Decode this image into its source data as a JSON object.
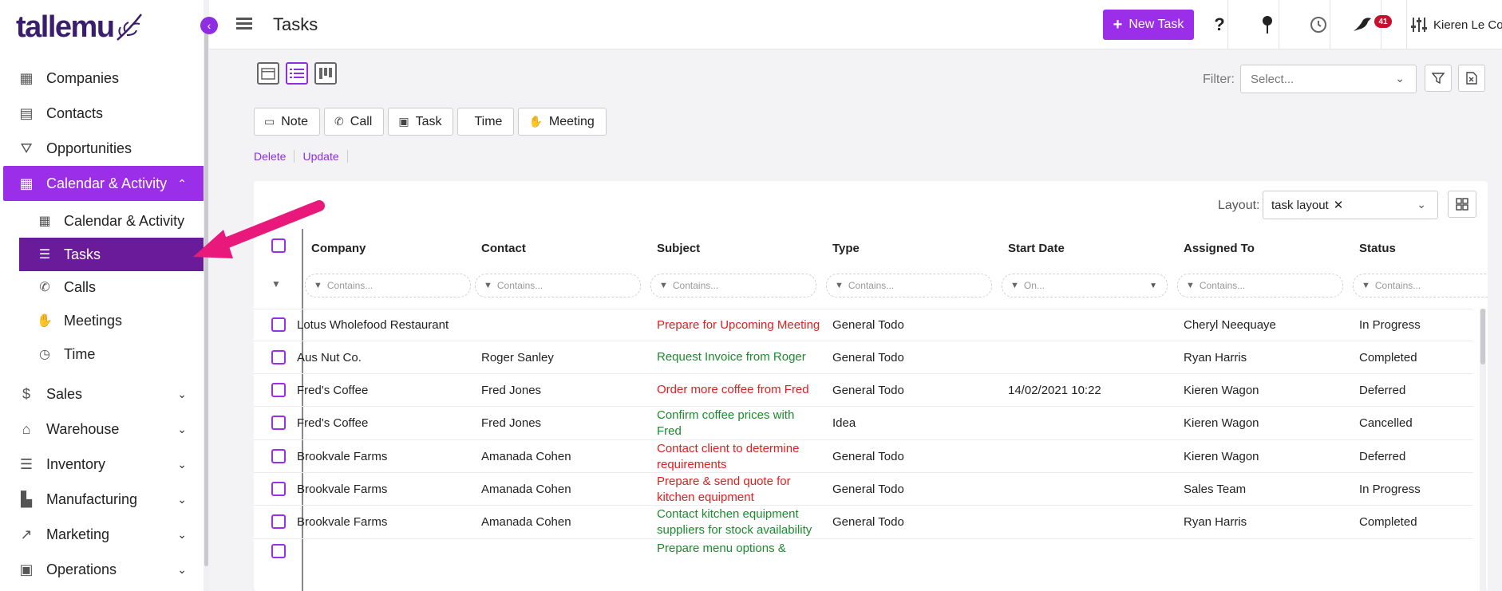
{
  "app": {
    "logo": "tallemu"
  },
  "sidebar": {
    "items": [
      {
        "label": "Companies",
        "icon": "building-icon",
        "glyph": "▦"
      },
      {
        "label": "Contacts",
        "icon": "contact-card-icon",
        "glyph": "▤"
      },
      {
        "label": "Opportunities",
        "icon": "funnel-icon",
        "glyph": "⛛"
      },
      {
        "label": "Calendar & Activity",
        "icon": "calendar-icon",
        "glyph": "▦",
        "expanded": true
      },
      {
        "label": "Sales",
        "icon": "dollar-icon",
        "glyph": "$"
      },
      {
        "label": "Warehouse",
        "icon": "warehouse-icon",
        "glyph": "⌂"
      },
      {
        "label": "Inventory",
        "icon": "clipboard-icon",
        "glyph": "☰"
      },
      {
        "label": "Manufacturing",
        "icon": "factory-icon",
        "glyph": "▙"
      },
      {
        "label": "Marketing",
        "icon": "chart-icon",
        "glyph": "↗"
      },
      {
        "label": "Operations",
        "icon": "clipboard-check-icon",
        "glyph": "▣"
      }
    ],
    "sub_items": [
      {
        "label": "Calendar & Activity",
        "icon": "calendar-icon",
        "glyph": "▦"
      },
      {
        "label": "Tasks",
        "icon": "tasks-list-icon",
        "glyph": "☰",
        "active": true
      },
      {
        "label": "Calls",
        "icon": "phone-icon",
        "glyph": "✆"
      },
      {
        "label": "Meetings",
        "icon": "handshake-icon",
        "glyph": "✋"
      },
      {
        "label": "Time",
        "icon": "stopwatch-icon",
        "glyph": "◷"
      }
    ]
  },
  "topbar": {
    "title": "Tasks",
    "new_task_label": "New Task",
    "notification_count": "41",
    "user_name": "Kieren Le Cor"
  },
  "toolbar": {
    "filter_label": "Filter:",
    "filter_placeholder": "Select...",
    "actions": [
      "Note",
      "Call",
      "Task",
      "Time",
      "Meeting"
    ],
    "links": [
      "Delete",
      "Update"
    ]
  },
  "grid": {
    "layout_label": "Layout:",
    "layout_value": "task layout",
    "columns": [
      "Company",
      "Contact",
      "Subject",
      "Type",
      "Start Date",
      "Assigned To",
      "Status"
    ],
    "filter_placeholders": [
      "Contains...",
      "Contains...",
      "Contains...",
      "Contains...",
      "On...",
      "Contains...",
      "Contains..."
    ],
    "rows": [
      {
        "company": "Lotus Wholefood Restaurant",
        "contact": "",
        "subject": [
          "Prepare for Upcoming Meeting"
        ],
        "subject_color": "red",
        "type": "General Todo",
        "start": "",
        "assigned": "Cheryl Neequaye",
        "status": "In Progress"
      },
      {
        "company": "Aus Nut Co.",
        "contact": "Roger Sanley",
        "subject": [
          "Request Invoice from Roger"
        ],
        "subject_color": "green",
        "type": "General Todo",
        "start": "",
        "assigned": "Ryan Harris",
        "status": "Completed"
      },
      {
        "company": "Fred's Coffee",
        "contact": "Fred Jones",
        "subject": [
          "Order more coffee from Fred"
        ],
        "subject_color": "red",
        "type": "General Todo",
        "start": "14/02/2021 10:22",
        "assigned": "Kieren Wagon",
        "status": "Deferred"
      },
      {
        "company": "Fred's Coffee",
        "contact": "Fred Jones",
        "subject": [
          "Confirm coffee prices with",
          "Fred"
        ],
        "subject_color": "green",
        "type": "Idea",
        "start": "",
        "assigned": "Kieren Wagon",
        "status": "Cancelled"
      },
      {
        "company": "Brookvale Farms",
        "contact": "Amanada Cohen",
        "subject": [
          "Contact client to determine",
          "requirements"
        ],
        "subject_color": "red",
        "type": "General Todo",
        "start": "",
        "assigned": "Kieren Wagon",
        "status": "Deferred"
      },
      {
        "company": "Brookvale Farms",
        "contact": "Amanada Cohen",
        "subject": [
          "Prepare & send quote for",
          "kitchen equipment"
        ],
        "subject_color": "red",
        "type": "General Todo",
        "start": "",
        "assigned": "Sales Team",
        "status": "In Progress"
      },
      {
        "company": "Brookvale Farms",
        "contact": "Amanada Cohen",
        "subject": [
          "Contact kitchen equipment",
          "suppliers for stock availability"
        ],
        "subject_color": "green",
        "type": "General Todo",
        "start": "",
        "assigned": "Ryan Harris",
        "status": "Completed"
      },
      {
        "company": "",
        "contact": "",
        "subject": [
          "Prepare menu options &"
        ],
        "subject_color": "green",
        "type": "",
        "start": "",
        "assigned": "",
        "status": ""
      }
    ]
  },
  "colors": {
    "accent": "#9b2ee8",
    "active_sub": "#6a1b9a",
    "arrow": "#e8197a",
    "red": "#e02020",
    "green": "#1e8a2e"
  }
}
